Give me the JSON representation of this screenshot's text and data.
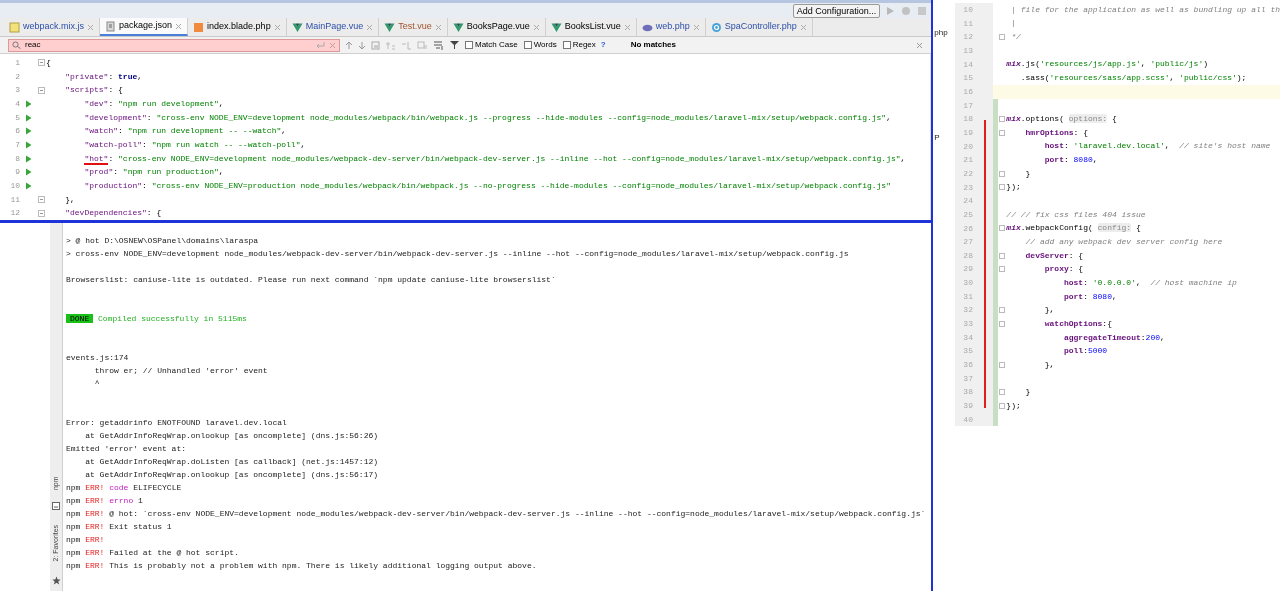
{
  "toolbar": {
    "run_config_button": "Add Configuration..."
  },
  "tabs": [
    {
      "label": "webpack.mix.js",
      "kind": "js",
      "modified": true,
      "unversioned": false,
      "selected": false
    },
    {
      "label": "package.json",
      "kind": "json",
      "modified": false,
      "unversioned": false,
      "selected": true
    },
    {
      "label": "index.blade.php",
      "kind": "blade",
      "modified": false,
      "unversioned": false,
      "selected": false
    },
    {
      "label": "MainPage.vue",
      "kind": "vue",
      "modified": true,
      "unversioned": false,
      "selected": false
    },
    {
      "label": "Test.vue",
      "kind": "vue",
      "unversioned": true,
      "selected": false
    },
    {
      "label": "BooksPage.vue",
      "kind": "vue",
      "modified": false,
      "unversioned": false,
      "selected": false
    },
    {
      "label": "BooksList.vue",
      "kind": "vue",
      "modified": false,
      "unversioned": false,
      "selected": false
    },
    {
      "label": "web.php",
      "kind": "php",
      "modified": true,
      "unversioned": false,
      "selected": false
    },
    {
      "label": "SpaController.php",
      "kind": "class",
      "modified": true,
      "unversioned": false,
      "selected": false
    }
  ],
  "search": {
    "value": "reac",
    "no_match": true,
    "options": [
      {
        "label": "Match Case",
        "checked": false
      },
      {
        "label": "Words",
        "checked": false
      },
      {
        "label": "Regex",
        "checked": false
      }
    ],
    "help": "?",
    "result": "No matches"
  },
  "editor": {
    "lines": [
      {
        "number": "1",
        "run": false,
        "fold": true,
        "tokens": [
          {
            "kind": "plain",
            "text": "{"
          }
        ]
      },
      {
        "number": "2",
        "run": false,
        "fold": false,
        "tokens": [
          {
            "kind": "key",
            "text": "    \"private\""
          },
          {
            "kind": "plain",
            "text": ": "
          },
          {
            "kind": "keyword",
            "text": "true"
          },
          {
            "kind": "plain",
            "text": ","
          }
        ]
      },
      {
        "number": "3",
        "run": false,
        "fold": true,
        "tokens": [
          {
            "kind": "key",
            "text": "    \"scripts\""
          },
          {
            "kind": "plain",
            "text": ": {"
          }
        ]
      },
      {
        "number": "4",
        "run": true,
        "fold": false,
        "tokens": [
          {
            "kind": "key",
            "text": "        \"dev\""
          },
          {
            "kind": "plain",
            "text": ": "
          },
          {
            "kind": "string",
            "text": "\"npm run development\""
          },
          {
            "kind": "plain",
            "text": ","
          }
        ]
      },
      {
        "number": "5",
        "run": true,
        "fold": false,
        "tokens": [
          {
            "kind": "key",
            "text": "        \"development\""
          },
          {
            "kind": "plain",
            "text": ": "
          },
          {
            "kind": "string",
            "text": "\"cross-env NODE_ENV=development node_modules/webpack/bin/webpack.js --progress --hide-modules --config=node_modules/laravel-mix/setup/webpack.config.js\""
          },
          {
            "kind": "plain",
            "text": ","
          }
        ]
      },
      {
        "number": "6",
        "run": true,
        "fold": false,
        "tokens": [
          {
            "kind": "key",
            "text": "        \"watch\""
          },
          {
            "kind": "plain",
            "text": ": "
          },
          {
            "kind": "string",
            "text": "\"npm run development -- --watch\""
          },
          {
            "kind": "plain",
            "text": ","
          }
        ]
      },
      {
        "number": "7",
        "run": true,
        "fold": false,
        "tokens": [
          {
            "kind": "key",
            "text": "        \"watch-poll\""
          },
          {
            "kind": "plain",
            "text": ": "
          },
          {
            "kind": "string",
            "text": "\"npm run watch -- --watch-poll\""
          },
          {
            "kind": "plain",
            "text": ","
          }
        ]
      },
      {
        "number": "8",
        "run": true,
        "fold": false,
        "tokens": [
          {
            "kind": "key",
            "text": "        \"hot\"",
            "underlined": true
          },
          {
            "kind": "plain",
            "text": ": "
          },
          {
            "kind": "string",
            "text": "\"cross-env NODE_ENV=development node_modules/webpack-dev-server/bin/webpack-dev-server.js --inline --hot --config=node_modules/laravel-mix/setup/webpack.config.js\""
          },
          {
            "kind": "plain",
            "text": ","
          }
        ]
      },
      {
        "number": "9",
        "run": true,
        "fold": false,
        "tokens": [
          {
            "kind": "key",
            "text": "        \"prod\""
          },
          {
            "kind": "plain",
            "text": ": "
          },
          {
            "kind": "string",
            "text": "\"npm run production\""
          },
          {
            "kind": "plain",
            "text": ","
          }
        ]
      },
      {
        "number": "10",
        "run": true,
        "fold": false,
        "tokens": [
          {
            "kind": "key",
            "text": "        \"production\""
          },
          {
            "kind": "plain",
            "text": ": "
          },
          {
            "kind": "string",
            "text": "\"cross-env NODE_ENV=production node_modules/webpack/bin/webpack.js --no-progress --hide-modules --config=node_modules/laravel-mix/setup/webpack.config.js\""
          }
        ]
      },
      {
        "number": "11",
        "run": false,
        "fold": true,
        "tokens": [
          {
            "kind": "plain",
            "text": "    },"
          }
        ]
      },
      {
        "number": "12",
        "run": false,
        "fold": true,
        "tokens": [
          {
            "kind": "key",
            "text": "    \"devDependencies\""
          },
          {
            "kind": "plain",
            "text": ": {"
          }
        ]
      }
    ]
  },
  "terminal": {
    "side_labels": [
      "npm",
      "2: Favorites"
    ],
    "lines": [
      {
        "kind": "text",
        "segments": [
          {
            "kind": "plain",
            "text": "> @ hot D:\\OSNEW\\OSPanel\\domains\\laraspa"
          }
        ]
      },
      {
        "kind": "text",
        "segments": [
          {
            "kind": "plain",
            "text": "> cross-env NODE_ENV=development node_modules/webpack-dev-server/bin/webpack-dev-server.js --inline --hot --config=node_modules/laravel-mix/setup/webpack.config.js"
          }
        ]
      },
      {
        "kind": "blank"
      },
      {
        "kind": "text",
        "segments": [
          {
            "kind": "plain",
            "text": "Browserslist: caniuse-lite is outdated. Please run next command `npm update caniuse-lite browserslist`"
          }
        ]
      },
      {
        "kind": "blank"
      },
      {
        "kind": "blank"
      },
      {
        "kind": "text",
        "segments": [
          {
            "kind": "badge",
            "text": "DONE"
          },
          {
            "kind": "success",
            "text": " Compiled successfully in 5115ms"
          }
        ]
      },
      {
        "kind": "blank"
      },
      {
        "kind": "blank"
      },
      {
        "kind": "text",
        "segments": [
          {
            "kind": "plain",
            "text": "events.js:174"
          }
        ]
      },
      {
        "kind": "text",
        "segments": [
          {
            "kind": "plain",
            "text": "      throw er; // Unhandled 'error' event"
          }
        ]
      },
      {
        "kind": "text",
        "segments": [
          {
            "kind": "plain",
            "text": "      ^"
          }
        ]
      },
      {
        "kind": "blank"
      },
      {
        "kind": "blank"
      },
      {
        "kind": "text",
        "segments": [
          {
            "kind": "plain",
            "text": "Error: getaddrinfo ENOTFOUND laravel.dev.local"
          }
        ]
      },
      {
        "kind": "text",
        "segments": [
          {
            "kind": "plain",
            "text": "    at GetAddrInfoReqWrap.onlookup [as oncomplete] (dns.js:56:26)"
          }
        ]
      },
      {
        "kind": "text",
        "segments": [
          {
            "kind": "plain",
            "text": "Emitted 'error' event at:"
          }
        ]
      },
      {
        "kind": "text",
        "segments": [
          {
            "kind": "plain",
            "text": "    at GetAddrInfoReqWrap.doListen [as callback] (net.js:1457:12)"
          }
        ]
      },
      {
        "kind": "text",
        "segments": [
          {
            "kind": "plain",
            "text": "    at GetAddrInfoReqWrap.onlookup [as oncomplete] (dns.js:56:17)"
          }
        ]
      },
      {
        "kind": "text",
        "segments": [
          {
            "kind": "plain",
            "text": "npm "
          },
          {
            "kind": "err",
            "text": "ERR!"
          },
          {
            "kind": "magenta",
            "text": " code"
          },
          {
            "kind": "plain",
            "text": " ELIFECYCLE"
          }
        ]
      },
      {
        "kind": "text",
        "segments": [
          {
            "kind": "plain",
            "text": "npm "
          },
          {
            "kind": "err",
            "text": "ERR!"
          },
          {
            "kind": "magenta",
            "text": " errno"
          },
          {
            "kind": "plain",
            "text": " 1"
          }
        ]
      },
      {
        "kind": "text",
        "segments": [
          {
            "kind": "plain",
            "text": "npm "
          },
          {
            "kind": "err",
            "text": "ERR!"
          },
          {
            "kind": "plain",
            "text": " @ hot: `cross-env NODE_ENV=development node_modules/webpack-dev-server/bin/webpack-dev-server.js --inline --hot --config=node_modules/laravel-mix/setup/webpack.config.js`"
          }
        ]
      },
      {
        "kind": "text",
        "segments": [
          {
            "kind": "plain",
            "text": "npm "
          },
          {
            "kind": "err",
            "text": "ERR!"
          },
          {
            "kind": "plain",
            "text": " Exit status 1"
          }
        ]
      },
      {
        "kind": "text",
        "segments": [
          {
            "kind": "plain",
            "text": "npm "
          },
          {
            "kind": "err",
            "text": "ERR!"
          }
        ]
      },
      {
        "kind": "text",
        "segments": [
          {
            "kind": "plain",
            "text": "npm "
          },
          {
            "kind": "err",
            "text": "ERR!"
          },
          {
            "kind": "plain",
            "text": " Failed at the @ hot script."
          }
        ]
      },
      {
        "kind": "text",
        "segments": [
          {
            "kind": "plain",
            "text": "npm "
          },
          {
            "kind": "err",
            "text": "ERR!"
          },
          {
            "kind": "plain",
            "text": " This is probably not a problem with npm. There is likely additional logging output above."
          }
        ]
      }
    ]
  },
  "side_editor": {
    "fragments": [
      "php",
      "P"
    ],
    "lines": [
      {
        "number": "10",
        "current": false,
        "changed": false,
        "fold": false,
        "tokens": [
          {
            "kind": "comment",
            "text": " | file for the application as well as bundling up all th"
          }
        ]
      },
      {
        "number": "11",
        "current": false,
        "changed": false,
        "fold": false,
        "tokens": [
          {
            "kind": "comment",
            "text": " |"
          }
        ]
      },
      {
        "number": "12",
        "current": false,
        "changed": false,
        "fold": true,
        "tokens": [
          {
            "kind": "comment",
            "text": " */"
          }
        ]
      },
      {
        "number": "13",
        "current": false,
        "changed": false,
        "fold": false
      },
      {
        "number": "14",
        "current": false,
        "changed": false,
        "fold": false,
        "tokens": [
          {
            "kind": "ident",
            "text": "mix"
          },
          {
            "kind": "plain",
            "text": ".js("
          },
          {
            "kind": "string",
            "text": "'resources/js/app.js'"
          },
          {
            "kind": "plain",
            "text": ", "
          },
          {
            "kind": "string",
            "text": "'public/js'"
          },
          {
            "kind": "plain",
            "text": ")"
          }
        ]
      },
      {
        "number": "15",
        "current": false,
        "changed": false,
        "fold": false,
        "tokens": [
          {
            "kind": "plain",
            "text": "   .sass("
          },
          {
            "kind": "string",
            "text": "'resources/sass/app.scss'"
          },
          {
            "kind": "plain",
            "text": ", "
          },
          {
            "kind": "string",
            "text": "'public/css'"
          },
          {
            "kind": "plain",
            "text": ");"
          }
        ]
      },
      {
        "number": "16",
        "current": true,
        "changed": false,
        "fold": false
      },
      {
        "number": "17",
        "current": false,
        "changed": true,
        "fold": false
      },
      {
        "number": "18",
        "current": false,
        "changed": true,
        "fold": true,
        "tokens": [
          {
            "kind": "ident",
            "text": "mix"
          },
          {
            "kind": "plain",
            "text": ".options( "
          },
          {
            "kind": "hint",
            "text": "options:"
          },
          {
            "kind": "plain",
            "text": " {"
          }
        ]
      },
      {
        "number": "19",
        "current": false,
        "changed": true,
        "fold": true,
        "tokens": [
          {
            "kind": "prop",
            "text": "    hmrOptions"
          },
          {
            "kind": "plain",
            "text": ": {"
          }
        ]
      },
      {
        "number": "20",
        "current": false,
        "changed": true,
        "fold": false,
        "tokens": [
          {
            "kind": "prop",
            "text": "        host"
          },
          {
            "kind": "plain",
            "text": ": "
          },
          {
            "kind": "string",
            "text": "'laravel.dev.local'"
          },
          {
            "kind": "plain",
            "text": ",  "
          },
          {
            "kind": "comment",
            "text": "// site's host name"
          }
        ]
      },
      {
        "number": "21",
        "current": false,
        "changed": true,
        "fold": false,
        "tokens": [
          {
            "kind": "prop",
            "text": "        port"
          },
          {
            "kind": "plain",
            "text": ": "
          },
          {
            "kind": "number",
            "text": "8080"
          },
          {
            "kind": "plain",
            "text": ","
          }
        ]
      },
      {
        "number": "22",
        "current": false,
        "changed": true,
        "fold": true,
        "tokens": [
          {
            "kind": "plain",
            "text": "    }"
          }
        ]
      },
      {
        "number": "23",
        "current": false,
        "changed": true,
        "fold": true,
        "tokens": [
          {
            "kind": "plain",
            "text": "});"
          }
        ]
      },
      {
        "number": "24",
        "current": false,
        "changed": true,
        "fold": false
      },
      {
        "number": "25",
        "current": false,
        "changed": true,
        "fold": false,
        "tokens": [
          {
            "kind": "comment",
            "text": "// // fix css files 404 issue"
          }
        ]
      },
      {
        "number": "26",
        "current": false,
        "changed": true,
        "fold": true,
        "tokens": [
          {
            "kind": "ident",
            "text": "mix"
          },
          {
            "kind": "plain",
            "text": ".webpackConfig( "
          },
          {
            "kind": "hint",
            "text": "config:"
          },
          {
            "kind": "plain",
            "text": " {"
          }
        ]
      },
      {
        "number": "27",
        "current": false,
        "changed": true,
        "fold": false,
        "tokens": [
          {
            "kind": "comment",
            "text": "    // add any webpack dev server config here"
          }
        ]
      },
      {
        "number": "28",
        "current": false,
        "changed": true,
        "fold": true,
        "tokens": [
          {
            "kind": "prop",
            "text": "    devServer"
          },
          {
            "kind": "plain",
            "text": ": {"
          }
        ]
      },
      {
        "number": "29",
        "current": false,
        "changed": true,
        "fold": true,
        "tokens": [
          {
            "kind": "prop",
            "text": "        proxy"
          },
          {
            "kind": "plain",
            "text": ": {"
          }
        ]
      },
      {
        "number": "30",
        "current": false,
        "changed": true,
        "fold": false,
        "tokens": [
          {
            "kind": "prop",
            "text": "            host"
          },
          {
            "kind": "plain",
            "text": ": "
          },
          {
            "kind": "string",
            "text": "'0.0.0.0'"
          },
          {
            "kind": "plain",
            "text": ",  "
          },
          {
            "kind": "comment",
            "text": "// host machine ip"
          }
        ]
      },
      {
        "number": "31",
        "current": false,
        "changed": true,
        "fold": false,
        "tokens": [
          {
            "kind": "prop",
            "text": "            port"
          },
          {
            "kind": "plain",
            "text": ": "
          },
          {
            "kind": "number",
            "text": "8080"
          },
          {
            "kind": "plain",
            "text": ","
          }
        ]
      },
      {
        "number": "32",
        "current": false,
        "changed": true,
        "fold": true,
        "tokens": [
          {
            "kind": "plain",
            "text": "        },"
          }
        ]
      },
      {
        "number": "33",
        "current": false,
        "changed": true,
        "fold": true,
        "tokens": [
          {
            "kind": "prop",
            "text": "        watchOptions"
          },
          {
            "kind": "plain",
            "text": ":{"
          }
        ]
      },
      {
        "number": "34",
        "current": false,
        "changed": true,
        "fold": false,
        "tokens": [
          {
            "kind": "prop",
            "text": "            aggregateTimeout"
          },
          {
            "kind": "plain",
            "text": ":"
          },
          {
            "kind": "number",
            "text": "200"
          },
          {
            "kind": "plain",
            "text": ","
          }
        ]
      },
      {
        "number": "35",
        "current": false,
        "changed": true,
        "fold": false,
        "tokens": [
          {
            "kind": "prop",
            "text": "            poll"
          },
          {
            "kind": "plain",
            "text": ":"
          },
          {
            "kind": "number",
            "text": "5000"
          }
        ]
      },
      {
        "number": "36",
        "current": false,
        "changed": true,
        "fold": true,
        "tokens": [
          {
            "kind": "plain",
            "text": "        },"
          }
        ]
      },
      {
        "number": "37",
        "current": false,
        "changed": true,
        "fold": false
      },
      {
        "number": "38",
        "current": false,
        "changed": true,
        "fold": true,
        "tokens": [
          {
            "kind": "plain",
            "text": "    }"
          }
        ]
      },
      {
        "number": "39",
        "current": false,
        "changed": true,
        "fold": true,
        "tokens": [
          {
            "kind": "plain",
            "text": "});"
          }
        ]
      },
      {
        "number": "40",
        "current": false,
        "changed": true,
        "fold": false
      }
    ]
  }
}
